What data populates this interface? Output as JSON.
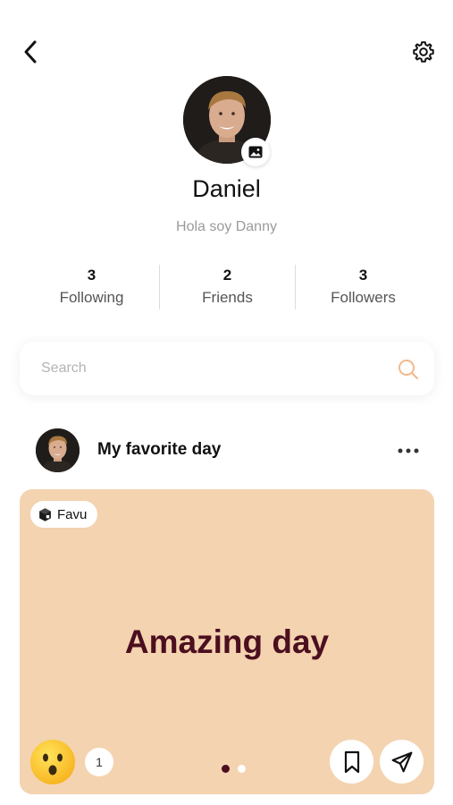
{
  "profile": {
    "name": "Daniel",
    "bio": "Hola soy Danny"
  },
  "icons": {
    "back": "chevron-left-icon",
    "settings": "gear-icon",
    "photo": "image-icon",
    "search": "search-icon",
    "more": "more-horizontal-icon",
    "bookmark": "bookmark-icon",
    "share": "send-icon",
    "tag": "cube-icon"
  },
  "stats": [
    {
      "value": "3",
      "label": "Following"
    },
    {
      "value": "2",
      "label": "Friends"
    },
    {
      "value": "3",
      "label": "Followers"
    }
  ],
  "search": {
    "placeholder": "Search"
  },
  "post": {
    "title": "My favorite day",
    "tag_label": "Favu",
    "card_text": "Amazing day",
    "reaction_emoji": "surprised-face",
    "reaction_count": "1",
    "page_count": 2,
    "active_page": 1
  },
  "colors": {
    "card_background": "#f4d3b0",
    "card_text": "#4b0f1f",
    "search_icon": "#f3b98c",
    "muted_text": "#9b9b9b"
  }
}
